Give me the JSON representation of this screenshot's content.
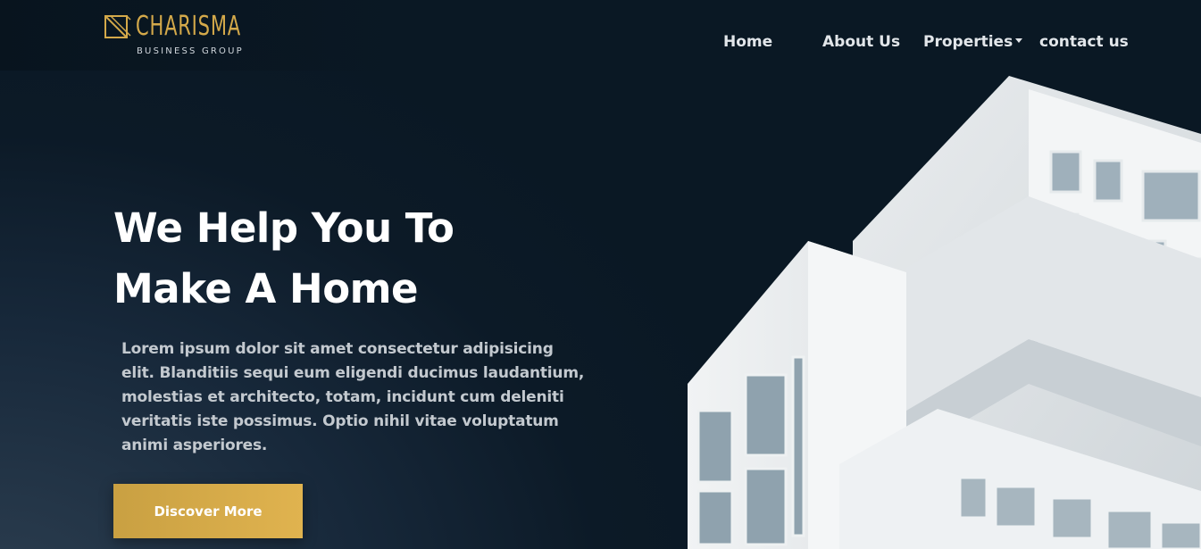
{
  "brand": {
    "name": "CHARISMA",
    "tagline": "BUSINESS GROUP",
    "color": "#d4a94a"
  },
  "nav": {
    "items": [
      {
        "label": "Home"
      },
      {
        "label": "About Us"
      },
      {
        "label": "Properties",
        "has_dropdown": true
      },
      {
        "label": "contact us"
      }
    ]
  },
  "hero": {
    "title_line1": "We Help You To",
    "title_line2": "Make A Home",
    "body": "Lorem ipsum dolor sit amet consectetur adipisicing elit. Blanditiis sequi eum eligendi ducimus laudantium, molestias et architecto, totam, incidunt cum deleniti veritatis iste possimus. Optio nihil vitae voluptatum animi asperiores.",
    "cta_label": "Discover More",
    "cta_color": "#d8ab4a"
  },
  "image": {
    "subject": "white modern building"
  }
}
